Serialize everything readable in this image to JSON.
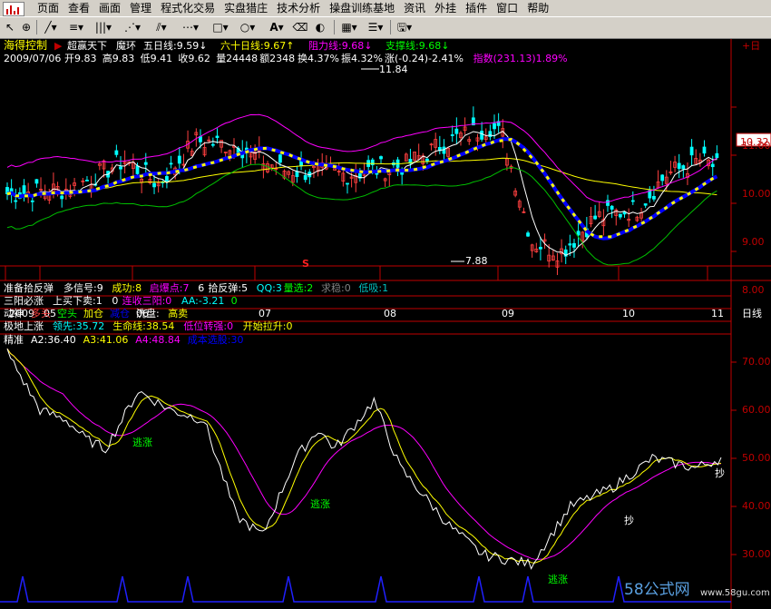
{
  "menu": [
    "页面",
    "查看",
    "画面",
    "管理",
    "程式化交易",
    "实盘猎庄",
    "技术分析",
    "操盘训练基地",
    "资讯",
    "外挂",
    "插件",
    "窗口",
    "帮助"
  ],
  "toolbar": {
    "text_tool": "A"
  },
  "main_panel": {
    "indicator_name": "海得控制",
    "items": [
      {
        "label": "超赢天下",
        "color": "#ffffff"
      },
      {
        "label": "魔环",
        "color": "#ffffff"
      },
      {
        "label": "五日线:9.59",
        "arrow": "↓",
        "color": "#ffffff"
      },
      {
        "label": "六十日线:9.67",
        "arrow": "↑",
        "color": "#ffff00"
      },
      {
        "label": "阻力线:9.68",
        "arrow": "↓",
        "color": "#ff00ff"
      },
      {
        "label": "支撑线:9.68",
        "arrow": "↓",
        "color": "#00ff00"
      }
    ],
    "quote": {
      "date": "2009/07/06",
      "open": "开9.83",
      "high": "高9.83",
      "low": "低9.41",
      "close": "收9.62",
      "volume": "量24448",
      "amount": "额2348",
      "turnover": "换4.37%",
      "amplitude": "振4.32%",
      "change": "涨(-0.24)-2.41%",
      "index": "指数(231.13)1.89%"
    },
    "high_mark": "11.84",
    "low_mark": "7.88",
    "current_price": "10.32",
    "y_ticks": [
      "11.00",
      "10.00",
      "9.00",
      "8.00"
    ],
    "top_right_icon": "+日",
    "signal_marker": "S"
  },
  "time_axis": {
    "labels": [
      "2009",
      "05",
      "06",
      "07",
      "08",
      "09",
      "10",
      "11"
    ],
    "period": "日线"
  },
  "sub_rows": [
    {
      "name": "准备拾反弹",
      "items": [
        {
          "t": "多信号:9",
          "c": "#ffffff"
        },
        {
          "t": "成功:8",
          "c": "#ffff00"
        },
        {
          "t": "启爆点:7",
          "c": "#ff00ff"
        },
        {
          "t": "6",
          "c": "#ffffff"
        },
        {
          "t": "拾反弹:5",
          "c": "#ffffff"
        },
        {
          "t": "QQ:3",
          "c": "#00ffff"
        },
        {
          "t": "量选:2",
          "c": "#00ff00"
        },
        {
          "t": "求稳:0",
          "c": "#808080"
        },
        {
          "t": "低吸:1",
          "c": "#00c0c0"
        }
      ]
    },
    {
      "name": "三阳必涨",
      "items": [
        {
          "t": "上买下卖:1",
          "c": "#ffffff"
        },
        {
          "t": "0",
          "c": "#ffffff"
        },
        {
          "t": "连收三阳:0",
          "c": "#ff00ff"
        },
        {
          "t": "AA:-3.21",
          "c": "#00ffff"
        },
        {
          "t": "0",
          "c": "#00ff00"
        }
      ]
    },
    {
      "name": "动神",
      "items": [
        {
          "t": "多头",
          "c": "#ff4040"
        },
        {
          "t": "空头",
          "c": "#00ff00"
        },
        {
          "t": "加仓",
          "c": "#ffff00"
        },
        {
          "t": "减仓",
          "c": "#0000ff"
        },
        {
          "t": "洗盘:",
          "c": "#ffffff"
        },
        {
          "t": "高卖",
          "c": "#ffff00"
        }
      ]
    },
    {
      "name": "极地上涨",
      "items": [
        {
          "t": "领先:35.72",
          "c": "#00ffff"
        },
        {
          "t": "生命线:38.54",
          "c": "#ffff00"
        },
        {
          "t": "低位转强:0",
          "c": "#ff00ff"
        },
        {
          "t": "开始拉升:0",
          "c": "#ffff00"
        }
      ]
    }
  ],
  "lower_panel": {
    "name": "精准",
    "items": [
      {
        "t": "A2:36.40",
        "c": "#ffffff"
      },
      {
        "t": "A3:41.06",
        "c": "#ffff00"
      },
      {
        "t": "A4:48.84",
        "c": "#ff00ff"
      },
      {
        "t": "成本选股:30",
        "c": "#0000ff"
      }
    ],
    "y_ticks": [
      "70.00",
      "60.00",
      "50.00",
      "40.00",
      "30.00"
    ],
    "annotations": [
      {
        "t": "逃涨",
        "c": "#00ff00"
      },
      {
        "t": "逃涨",
        "c": "#00ff00"
      },
      {
        "t": "逃涨",
        "c": "#00ff00"
      },
      {
        "t": "抄",
        "c": "#ffffff"
      },
      {
        "t": "抄",
        "c": "#ffffff"
      }
    ]
  },
  "watermark": {
    "brand": "58公式网",
    "url": "www.58gu.com"
  },
  "colors": {
    "background": "#000000",
    "frame": "#c00000",
    "up": "#ff4040",
    "down": "#00ffff",
    "ma5": "#ffffff",
    "ma60": "#ffff00",
    "band_upper": "#ff00ff",
    "band_lower": "#00c000",
    "trend": "#0000ff"
  }
}
